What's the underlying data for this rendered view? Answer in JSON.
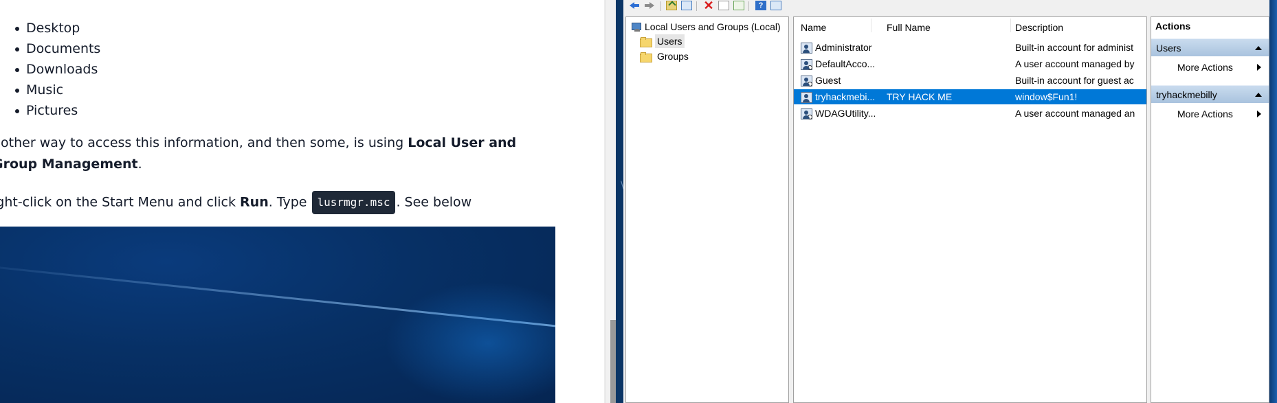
{
  "article": {
    "folders": [
      "Desktop",
      "Documents",
      "Downloads",
      "Music",
      "Pictures"
    ],
    "p1": {
      "text_before": "nother way to access this information, and then some, is using ",
      "bold": "Local User and Group Management",
      "text_after": "."
    },
    "p2": {
      "text_before": "ight-click on the Start Menu and click ",
      "bold_run": "Run",
      "text_mid": ". Type ",
      "code": "lusrmgr.msc",
      "text_after": ". See below"
    }
  },
  "desktop": {
    "edge_char": "\\"
  },
  "mmc": {
    "toolbar_icons": [
      "back-icon",
      "forward-icon",
      "up-level-icon",
      "show-tree-icon",
      "delete-icon",
      "properties-icon",
      "export-list-icon",
      "help-icon",
      "show-action-pane-icon"
    ],
    "tree": {
      "root": "Local Users and Groups (Local)",
      "children": [
        "Users",
        "Groups"
      ],
      "selected": "Users"
    },
    "columns": [
      "Name",
      "Full Name",
      "Description"
    ],
    "rows": [
      {
        "name": "Administrator",
        "full_name": "",
        "description": "Built-in account for administ",
        "selected": false
      },
      {
        "name": "DefaultAcco...",
        "full_name": "",
        "description": "A user account managed by",
        "selected": false
      },
      {
        "name": "Guest",
        "full_name": "",
        "description": "Built-in account for guest ac",
        "selected": false
      },
      {
        "name": "tryhackmebi...",
        "full_name": "TRY HACK ME",
        "description": "window$Fun1!",
        "selected": true
      },
      {
        "name": "WDAGUtility...",
        "full_name": "",
        "description": "A user account managed an",
        "selected": false
      }
    ],
    "actions": {
      "title": "Actions",
      "sections": [
        {
          "header": "Users",
          "items": [
            "More Actions"
          ]
        },
        {
          "header": "tryhackmebilly",
          "items": [
            "More Actions"
          ]
        }
      ]
    },
    "colors": {
      "selection": "#0078d7",
      "section_header": "#b9d1ea"
    }
  }
}
